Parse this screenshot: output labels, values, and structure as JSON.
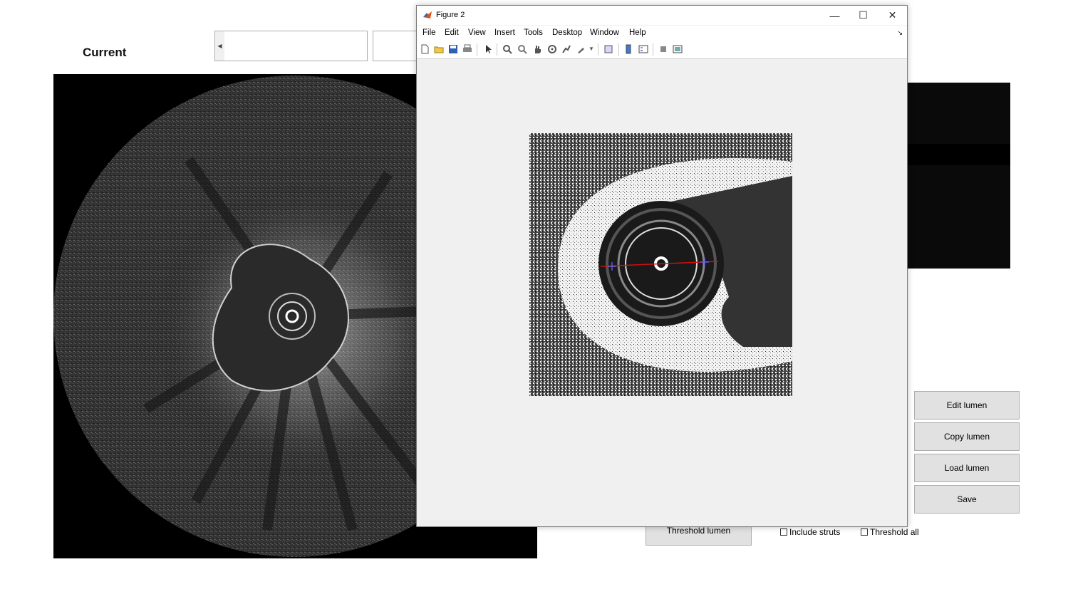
{
  "main": {
    "title": "Current",
    "buttons": {
      "edit_lumen": "Edit lumen",
      "copy_lumen": "Copy lumen",
      "load_lumen": "Load lumen",
      "save": "Save",
      "threshold_lumen": "Threshold lumen"
    },
    "checkboxes": {
      "include_struts": {
        "label": "Include struts",
        "checked": false
      },
      "threshold_all": {
        "label": "Threshold all",
        "checked": false
      }
    }
  },
  "figure": {
    "title": "Figure 2",
    "menu": [
      "File",
      "Edit",
      "View",
      "Insert",
      "Tools",
      "Desktop",
      "Window",
      "Help"
    ],
    "toolbar_icons": [
      "new-file-icon",
      "open-folder-icon",
      "save-icon",
      "print-icon",
      "pointer-icon",
      "zoom-in-icon",
      "zoom-out-icon",
      "pan-icon",
      "rotate-icon",
      "data-cursor-icon",
      "brush-icon",
      "link-icon",
      "colorbar-icon",
      "legend-icon",
      "hide-plot-tools-icon",
      "show-plot-tools-icon"
    ],
    "colors": {
      "line": "#d01010",
      "marker": "#6a6aff"
    }
  }
}
